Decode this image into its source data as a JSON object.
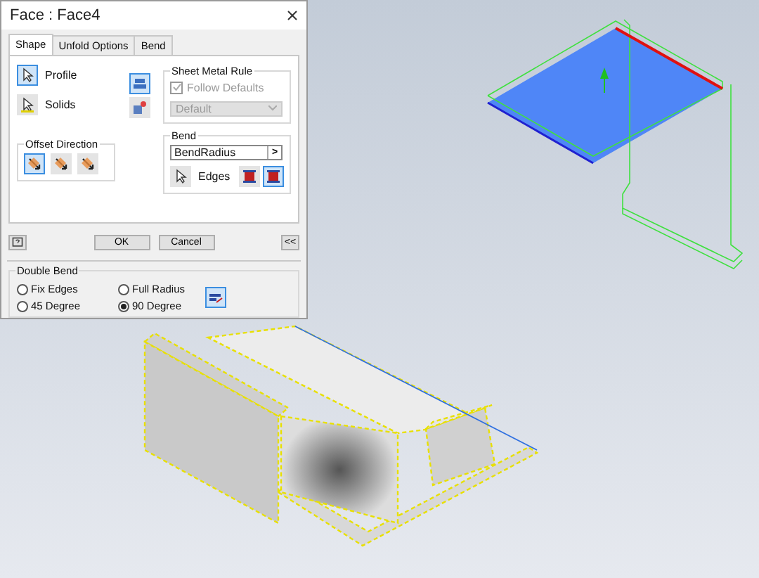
{
  "window": {
    "title": "Face : Face4"
  },
  "tabs": [
    {
      "label": "Shape",
      "selected": true
    },
    {
      "label": "Unfold Options",
      "selected": false
    },
    {
      "label": "Bend",
      "selected": false
    }
  ],
  "shape": [
    {
      "label": "Profile",
      "selected": true
    },
    {
      "label": "Solids",
      "selected": false
    }
  ],
  "face_buttons": [
    {
      "selected": true
    },
    {
      "selected": false
    }
  ],
  "offset_direction": {
    "title": "Offset Direction",
    "options": [
      {
        "selected": true
      },
      {
        "selected": false
      },
      {
        "selected": false
      }
    ]
  },
  "sheet_metal_rule": {
    "title": "Sheet Metal Rule",
    "follow_defaults": {
      "label": "Follow Defaults",
      "checked": true,
      "disabled": true
    },
    "rule": {
      "value": "Default",
      "disabled": true
    }
  },
  "bend": {
    "title": "Bend",
    "radius": "BendRadius",
    "arrow": ">",
    "edges_label": "Edges",
    "extend_options": [
      {
        "selected": false
      },
      {
        "selected": true
      }
    ]
  },
  "buttons": [
    "OK",
    "Cancel"
  ],
  "collapse_button": "<<",
  "double_bend": {
    "title": "Double Bend",
    "options": [
      {
        "label": "Fix Edges",
        "selected": false
      },
      {
        "label": "Full Radius",
        "selected": false
      },
      {
        "label": "45 Degree",
        "selected": false
      },
      {
        "label": "90 Degree",
        "selected": true
      }
    ]
  }
}
